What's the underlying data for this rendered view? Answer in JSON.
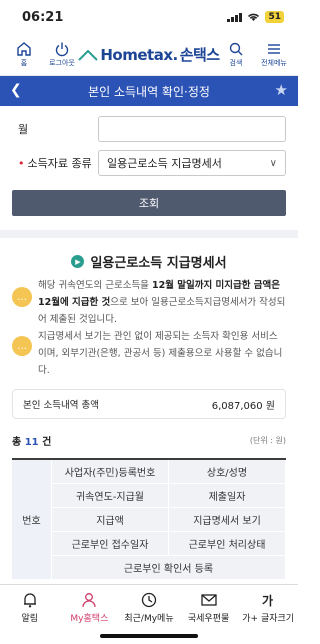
{
  "status": {
    "time": "06:21",
    "battery": "51"
  },
  "header": {
    "home_label": "홈",
    "logout_label": "로그아웃",
    "logo_text": "Hometax.",
    "logo_kor": "손택스",
    "search_label": "검색",
    "menu_label": "전체메뉴"
  },
  "titlebar": {
    "title": "본인 소득내역 확인·정정"
  },
  "form": {
    "month_label": "월",
    "month_value": "",
    "type_label": "소득자료 종류",
    "type_required": "•",
    "type_value": "일용근로소득 지급명세서",
    "search_button": "조회"
  },
  "section": {
    "title": "일용근로소득 지급명세서"
  },
  "notices": [
    {
      "pre": "해당 귀속연도의 근로소득을 ",
      "bold": "12월 말일까지 미지급한 금액은 12월에 지급한 것",
      "post": "으로 보아 일용근로소득지급명세서가 작성되어 제출된 것입니다."
    },
    {
      "pre": "지급명세서 보기는 관인 없이 제공되는 소득자 확인용 서비스이며, 외부기관(은행, 관공서 등) 제출용으로 사용할 수 없습니다.",
      "bold": "",
      "post": ""
    }
  ],
  "total": {
    "label": "본인 소득내역 총액",
    "amount": "6,087,060 원"
  },
  "count": {
    "prefix": "총",
    "number": "11",
    "suffix": "건",
    "unit": "(단위 : 원)"
  },
  "table": {
    "num_header": "번호",
    "headers": [
      "사업자(주민)등록번호",
      "상호/성명",
      "귀속연도-지급월",
      "제출일자",
      "지급액",
      "지급명세서 보기",
      "근로부인 접수일자",
      "근로부인 처리상태"
    ],
    "wide_header": "근로부인 확인서 등록"
  },
  "bottomnav": [
    {
      "label": "알림",
      "icon": "bell-icon"
    },
    {
      "label": "My홈택스",
      "icon": "person-icon"
    },
    {
      "label": "최근/My메뉴",
      "icon": "clock-icon"
    },
    {
      "label": "국세우편물",
      "icon": "mail-icon"
    },
    {
      "label": "가+ 글자크기",
      "icon": "text-size-icon"
    }
  ],
  "colors": {
    "brand": "#2b52b5",
    "accent": "#d13d6a",
    "notice_icon": "#f4c552"
  }
}
